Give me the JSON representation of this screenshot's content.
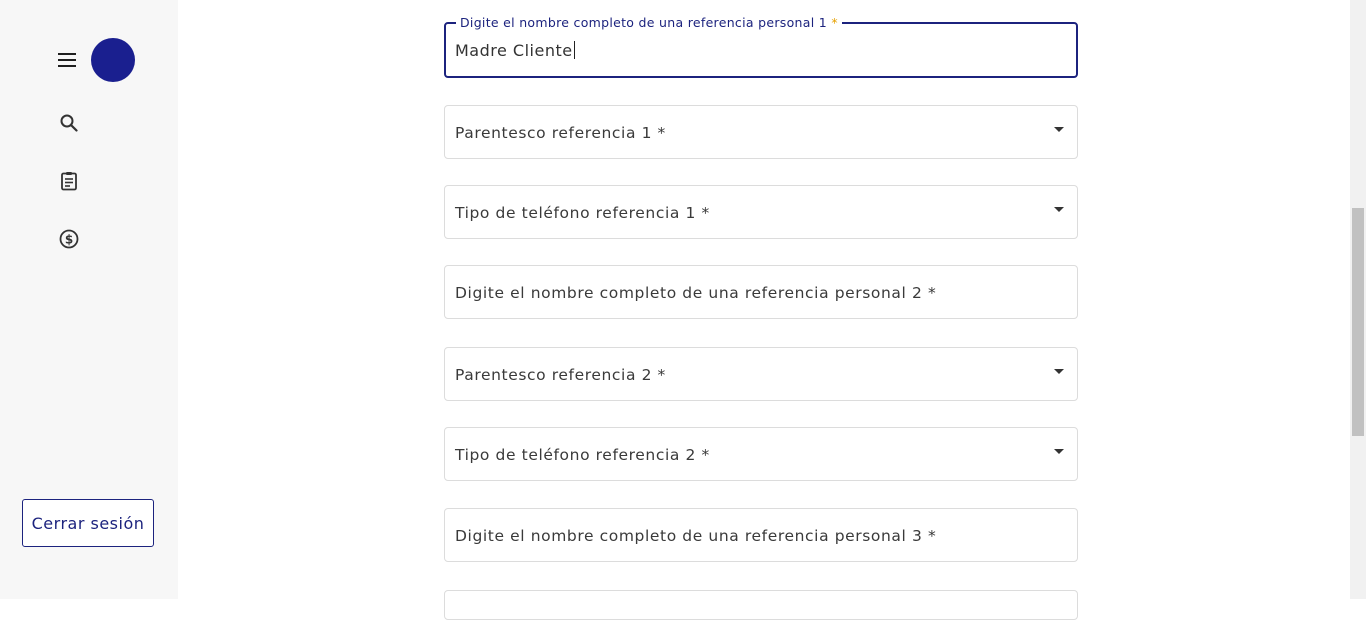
{
  "sidebar": {
    "icons": [
      "menu-icon",
      "search-icon",
      "clipboard-icon",
      "dollar-icon"
    ],
    "logout_label": "Cerrar sesión",
    "avatar_color": "#1a1f8f"
  },
  "form": {
    "active_field": {
      "label": "Digite el nombre completo de una referencia personal 1",
      "required_mark": "*",
      "value": "Madre Cliente"
    },
    "fields": [
      {
        "label": "Parentesco referencia 1 *",
        "type": "select"
      },
      {
        "label": "Tipo de teléfono referencia 1 *",
        "type": "select"
      },
      {
        "label": "Digite el nombre completo de una referencia personal 2 *",
        "type": "text"
      },
      {
        "label": "Parentesco referencia 2 *",
        "type": "select"
      },
      {
        "label": "Tipo de teléfono referencia 2 *",
        "type": "select"
      },
      {
        "label": "Digite el nombre completo de una referencia personal 3 *",
        "type": "text"
      }
    ]
  },
  "colors": {
    "accent": "#1c237e",
    "required": "#e6a100",
    "sidebar_bg": "#f7f7f7"
  }
}
